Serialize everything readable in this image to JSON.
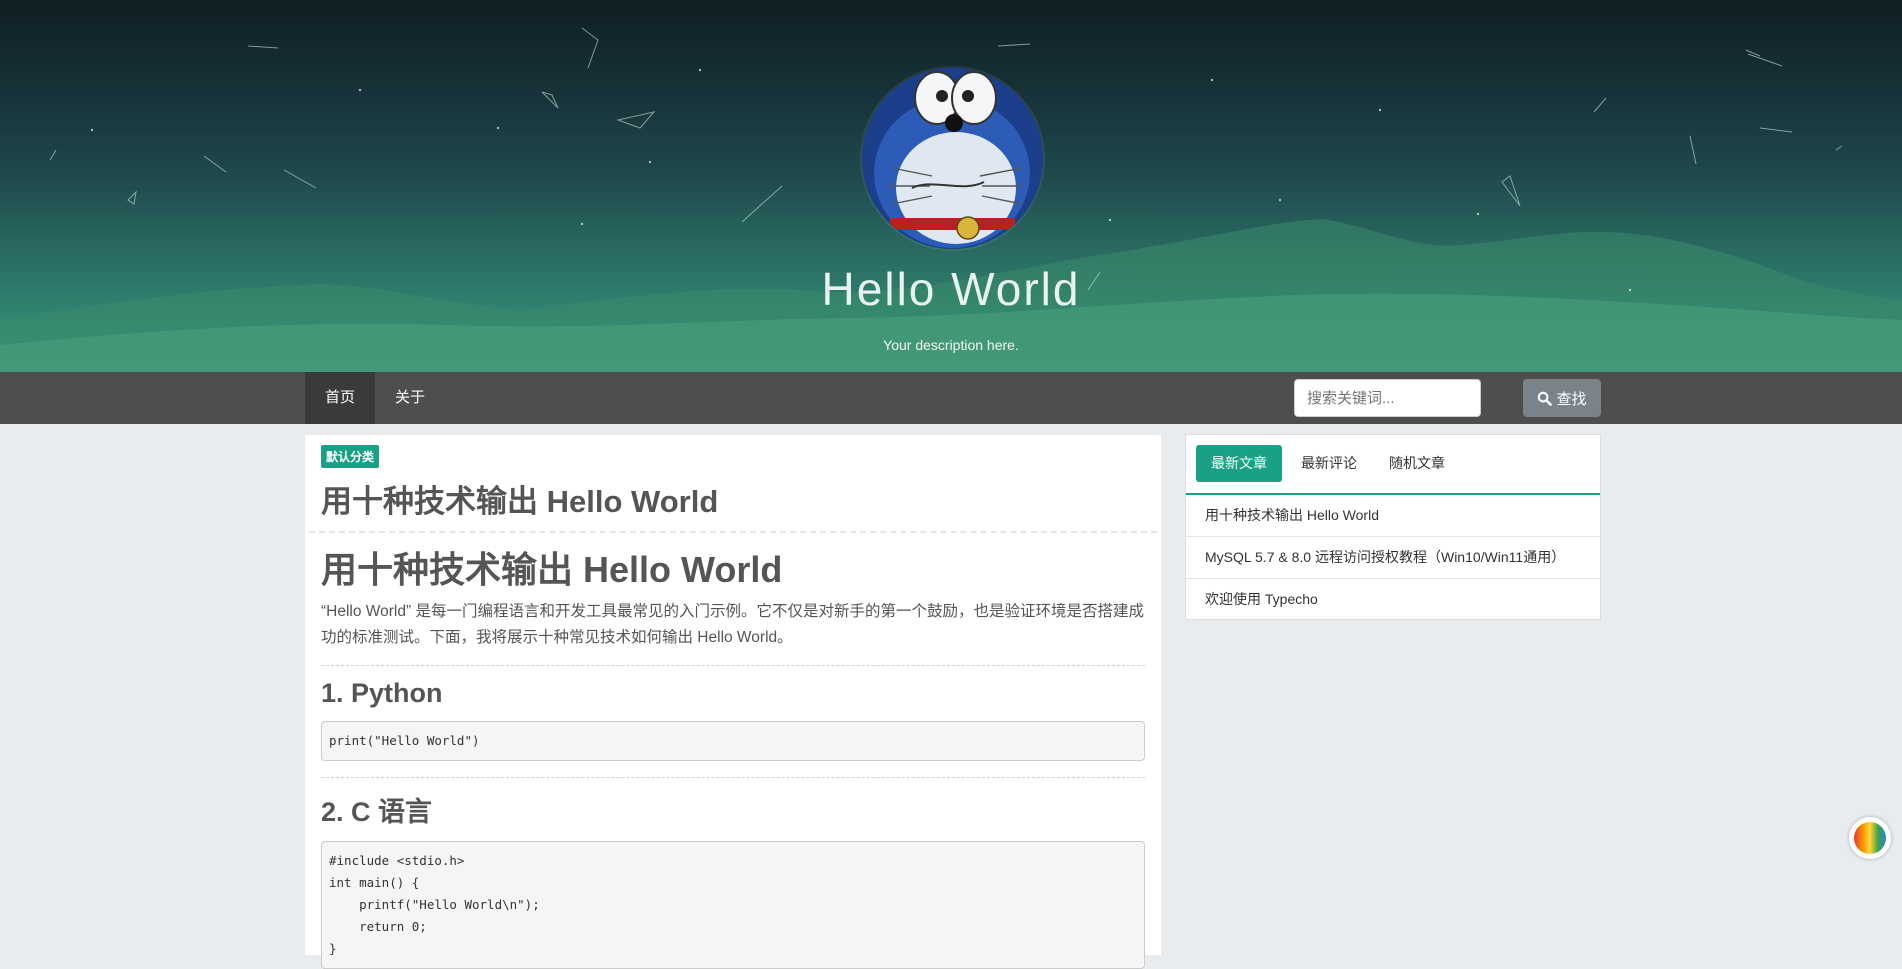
{
  "site": {
    "title": "Hello World",
    "description": "Your description here."
  },
  "nav": {
    "items": [
      {
        "label": "首页",
        "active": true
      },
      {
        "label": "关于",
        "active": false
      }
    ],
    "search_placeholder": "搜索关键词...",
    "search_button": "查找",
    "search_icon": "magnifier-icon"
  },
  "post": {
    "category": "默认分类",
    "title": "用十种技术输出 Hello World",
    "heading": "用十种技术输出 Hello World",
    "intro": "“Hello World” 是每一门编程语言和开发工具最常见的入门示例。它不仅是对新手的第一个鼓励，也是验证环境是否搭建成功的标准测试。下面，我将展示十种常见技术如何输出 Hello World。",
    "sections": [
      {
        "heading": "1. Python",
        "code": "print(\"Hello World\")"
      },
      {
        "heading": "2. C 语言",
        "code": "#include <stdio.h>\nint main() {\n    printf(\"Hello World\\n\");\n    return 0;\n}"
      }
    ]
  },
  "sidebar": {
    "tabs": [
      {
        "label": "最新文章",
        "active": true
      },
      {
        "label": "最新评论",
        "active": false
      },
      {
        "label": "随机文章",
        "active": false
      }
    ],
    "items": [
      "用十种技术输出 Hello World",
      "MySQL 5.7 & 8.0 远程访问授权教程（Win10/Win11通用）",
      "欢迎使用 Typecho"
    ]
  },
  "colors": {
    "accent": "#1aa185",
    "nav_bg": "#4e4e4e",
    "page_bg": "#e9ecef"
  },
  "widgets": {
    "theme_switcher_icon": "color-palette-icon"
  }
}
